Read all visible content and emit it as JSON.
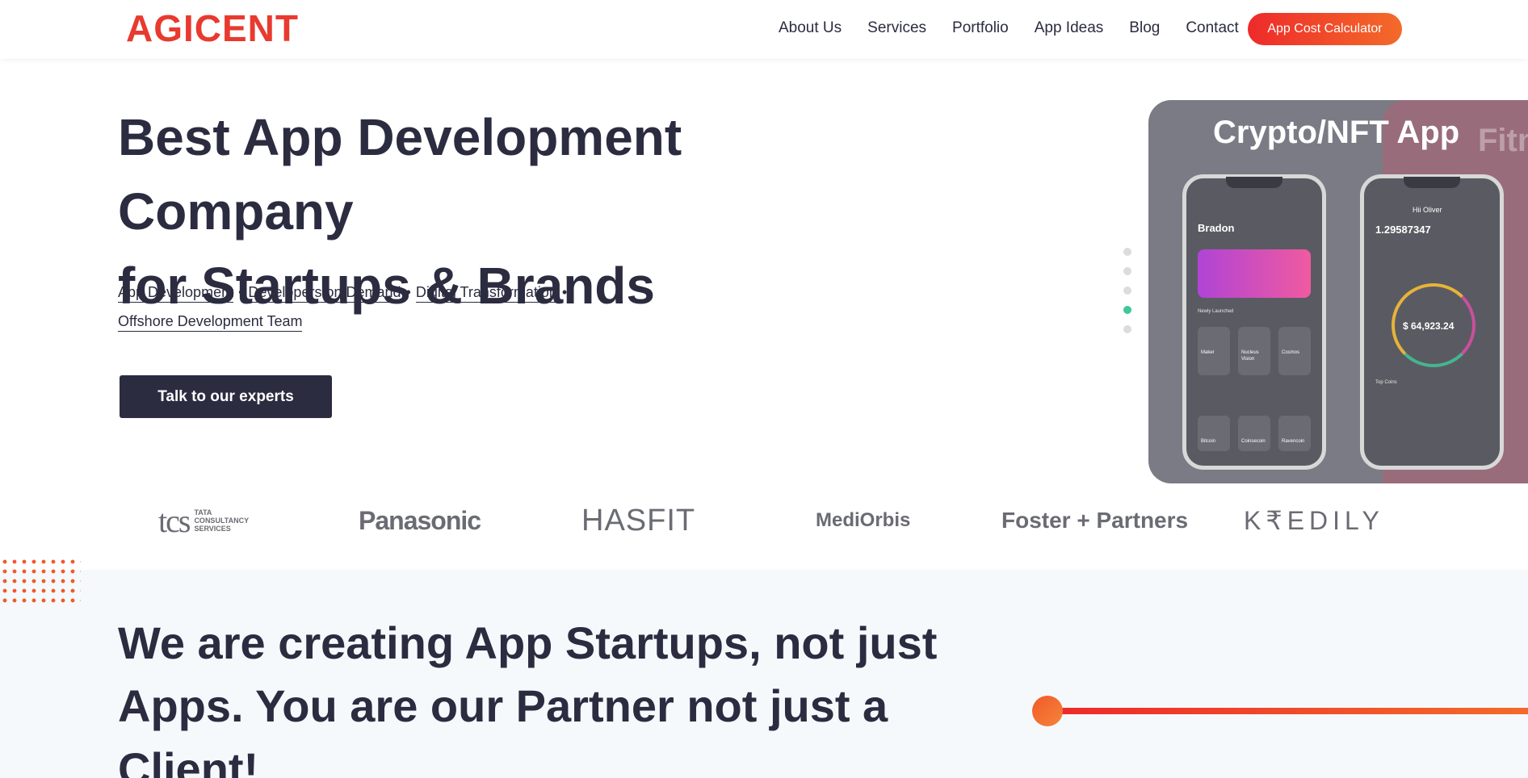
{
  "brand": {
    "name": "AGICENT",
    "color": "#e83a2f"
  },
  "nav": {
    "items": [
      "About Us",
      "Services",
      "Portfolio",
      "App Ideas",
      "Blog",
      "Contact"
    ],
    "cta": "App Cost Calculator"
  },
  "hero": {
    "title_line1": "Best App Development Company",
    "title_line2_prefix": "for ",
    "title_highlight": "Startups & Brands",
    "links": [
      "App Development",
      "Developers on Demand",
      "Digital Transformation",
      "Offshore Development Team"
    ],
    "separator": "•",
    "cta": "Talk to our experts"
  },
  "slider": {
    "dots": 5,
    "active_index": 3
  },
  "showcase": {
    "title": "Crypto/NFT App",
    "next_title": "Fitn",
    "phone1": {
      "name": "Bradon",
      "section": "Newly Launched",
      "tiles": [
        "Maker",
        "Nucleus Vision",
        "Cosmos"
      ],
      "tiles2": [
        "Bitcoin",
        "Coinsecoin",
        "Ravencoin"
      ]
    },
    "phone2": {
      "name": "1.29587347",
      "greeting": "Hii Oliver",
      "balance": "$ 64,923.24",
      "section": "Top Coins"
    }
  },
  "clients": {
    "tcs": {
      "mark": "tcs",
      "sub": [
        "TATA",
        "CONSULTANCY",
        "SERVICES"
      ]
    },
    "panasonic": "Panasonic",
    "hasfit": "HASFIT",
    "mediorbis": "MediOrbis",
    "foster": "Foster + Partners",
    "kredily": "K₹EDILY"
  },
  "section2": {
    "title": "We are creating App Startups, not just Apps. You are our Partner not just a Client!"
  }
}
